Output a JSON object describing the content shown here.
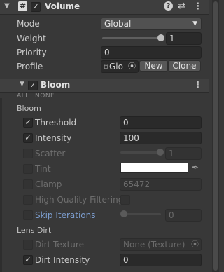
{
  "volume": {
    "title": "Volume",
    "hash_glyph": "#",
    "mode_label": "Mode",
    "mode_value": "Global",
    "weight_label": "Weight",
    "weight_value": "1",
    "weight_fraction": 1.0,
    "priority_label": "Priority",
    "priority_value": "0",
    "profile_label": "Profile",
    "profile_value": "Glo",
    "new_label": "New",
    "clone_label": "Clone"
  },
  "bloom": {
    "title": "Bloom",
    "all_label": "ALL",
    "none_label": "NONE",
    "section_label": "Bloom",
    "threshold_label": "Threshold",
    "threshold_value": "0",
    "intensity_label": "Intensity",
    "intensity_value": "100",
    "scatter_label": "Scatter",
    "scatter_value": "1",
    "scatter_fraction": 0.6,
    "tint_label": "Tint",
    "tint_color": "#ffffff",
    "clamp_label": "Clamp",
    "clamp_value": "65472",
    "hq_label": "High Quality Filtering",
    "skip_label": "Skip Iterations",
    "skip_value": "0",
    "skip_fraction": 0.0,
    "lens_dirt_label": "Lens Dirt",
    "dirt_texture_label": "Dirt Texture",
    "dirt_texture_value": "None (Texture)",
    "dirt_intensity_label": "Dirt Intensity",
    "dirt_intensity_value": "0"
  },
  "colors": {
    "background": "#383838",
    "link": "#7b9ccd"
  }
}
